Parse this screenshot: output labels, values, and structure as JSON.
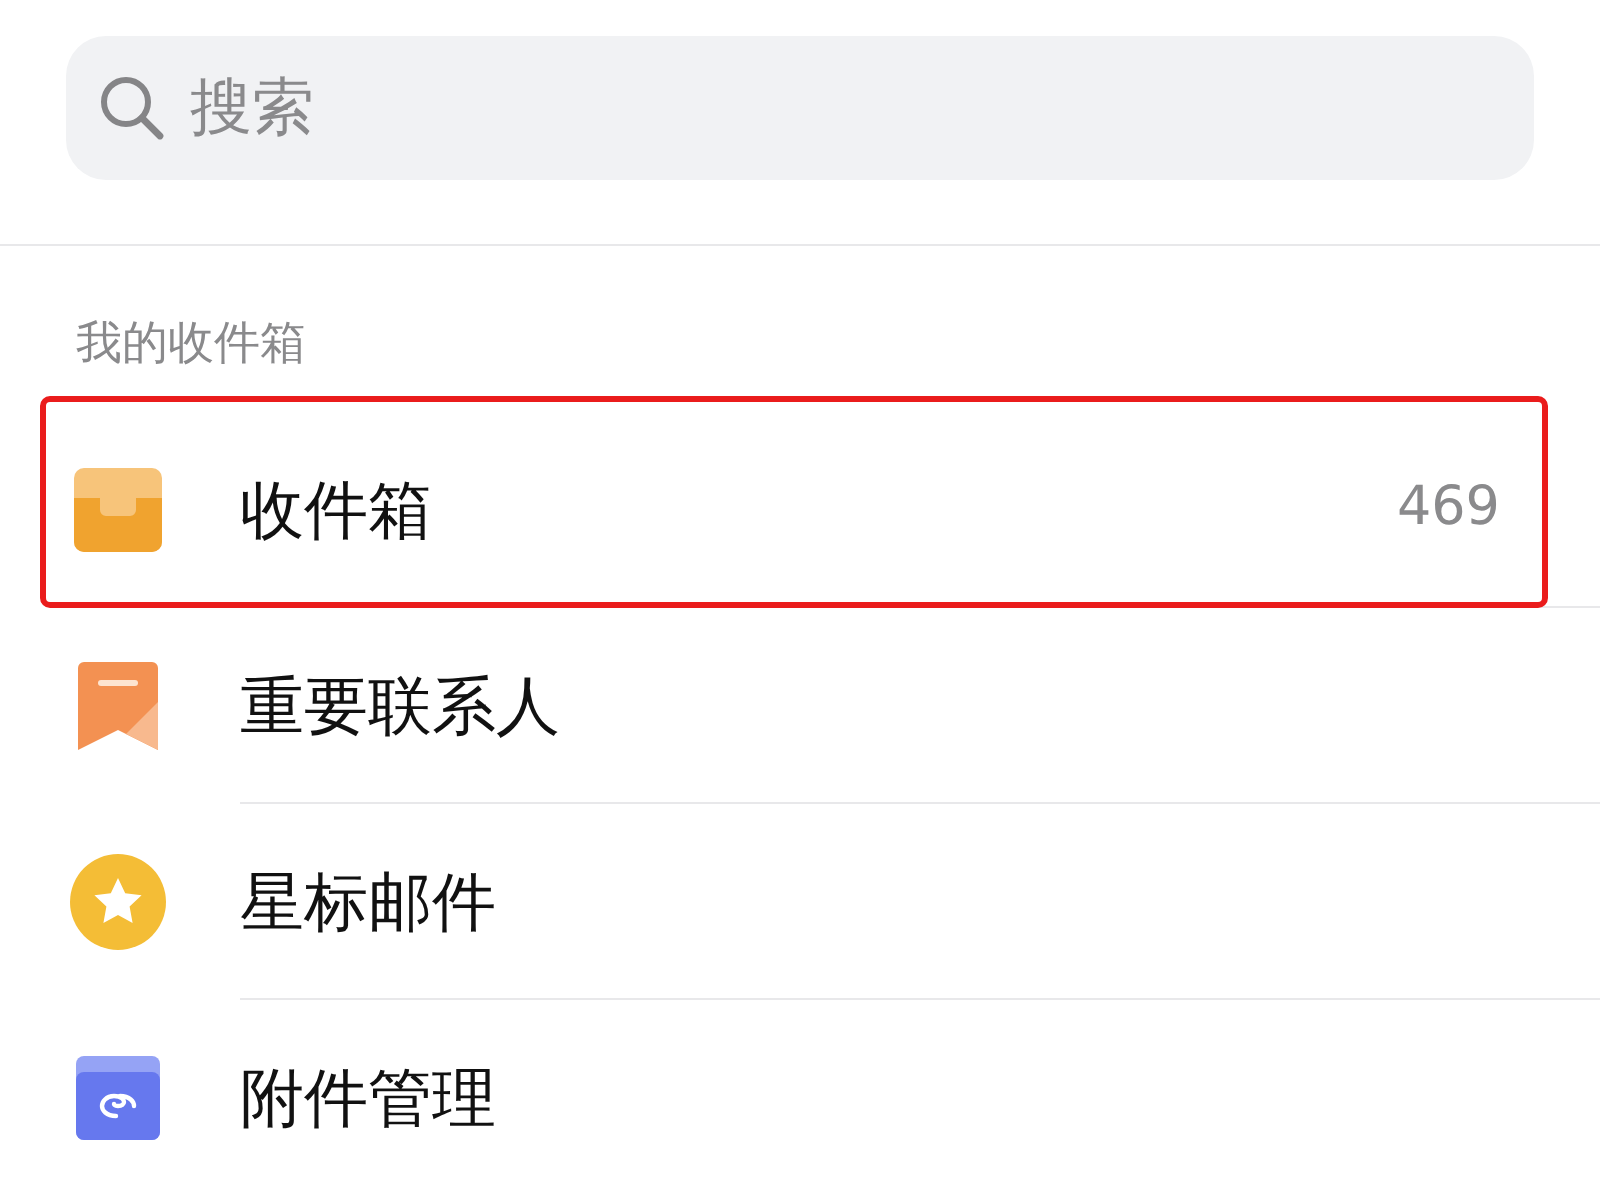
{
  "search": {
    "placeholder": "搜索"
  },
  "section": {
    "title": "我的收件箱"
  },
  "items": [
    {
      "kind": "inbox",
      "label": "收件箱",
      "count": "469",
      "highlighted": true
    },
    {
      "kind": "contacts",
      "label": "重要联系人",
      "highlighted": false
    },
    {
      "kind": "starred",
      "label": "星标邮件",
      "highlighted": false
    },
    {
      "kind": "attachments",
      "label": "附件管理",
      "highlighted": false
    }
  ]
}
